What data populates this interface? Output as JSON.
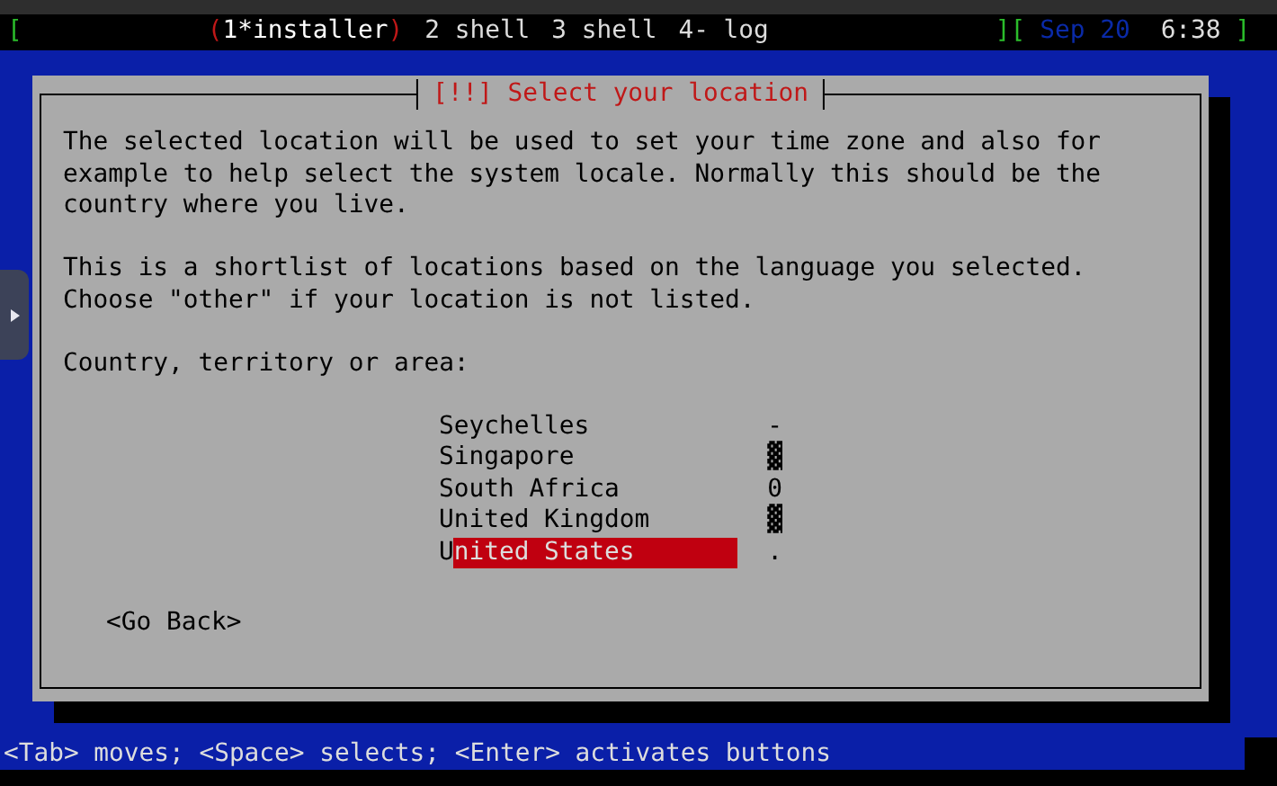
{
  "status_bar": {
    "left_bracket": "[",
    "windows": [
      {
        "label": "(1*installer)",
        "selected": true
      },
      {
        "label": "2 shell",
        "selected": false
      },
      {
        "label": "3 shell",
        "selected": false
      },
      {
        "label": "4- log",
        "selected": false
      }
    ],
    "right_bracket": "]",
    "clock_open": "[",
    "date": "Sep 20",
    "time": "6:38",
    "clock_close": "]"
  },
  "dialog": {
    "title": "[!!] Select your location",
    "paragraphs": [
      "The selected location will be used to set your time zone and also for example to help select the system locale. Normally this should be the country where you live.",
      "This is a shortlist of locations based on the language you selected. Choose \"other\" if your location is not listed."
    ],
    "prompt": "Country, territory or area:",
    "options": [
      {
        "label": "Seychelles",
        "mark": "-",
        "selected": false
      },
      {
        "label": "Singapore",
        "mark": "▓",
        "selected": false
      },
      {
        "label": "South Africa",
        "mark": "0",
        "selected": false
      },
      {
        "label": "United Kingdom",
        "mark": "▓",
        "selected": false
      },
      {
        "label": "United States",
        "mark": ".",
        "selected": true
      }
    ],
    "buttons": [
      "<Go Back>"
    ]
  },
  "help_line": "<Tab> moves; <Space> selects; <Enter> activates buttons"
}
